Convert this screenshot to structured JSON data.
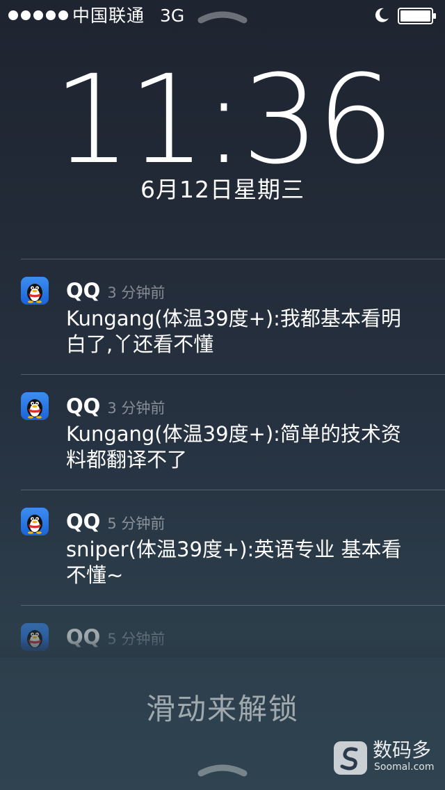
{
  "status_bar": {
    "carrier": "中国联通",
    "network": "3G",
    "signal_bars": 5,
    "moon_icon": "do-not-disturb-moon-icon",
    "battery_level": 1.0
  },
  "lock_screen": {
    "time": "11:36",
    "date": "6月12日星期三",
    "slide_to_unlock": "滑动来解锁"
  },
  "notifications": [
    {
      "app": "QQ",
      "time_ago": "3 分钟前",
      "message": "Kungang(体温39度+):我都基本看明白了,丫还看不懂",
      "icon": "qq-penguin-icon"
    },
    {
      "app": "QQ",
      "time_ago": "3 分钟前",
      "message": "Kungang(体温39度+):简单的技术资料都翻译不了",
      "icon": "qq-penguin-icon"
    },
    {
      "app": "QQ",
      "time_ago": "5 分钟前",
      "message": "sniper(体温39度+):英语专业 基本看不懂~",
      "icon": "qq-penguin-icon"
    },
    {
      "app": "QQ",
      "time_ago": "5 分钟前",
      "message": "",
      "icon": "qq-penguin-icon"
    }
  ],
  "watermark": {
    "text": "数码多",
    "sub": "Soomal.com"
  },
  "colors": {
    "qq_icon_blue": "#1a63d6",
    "background_top": "#1e2430",
    "background_bottom": "#2f4350"
  }
}
